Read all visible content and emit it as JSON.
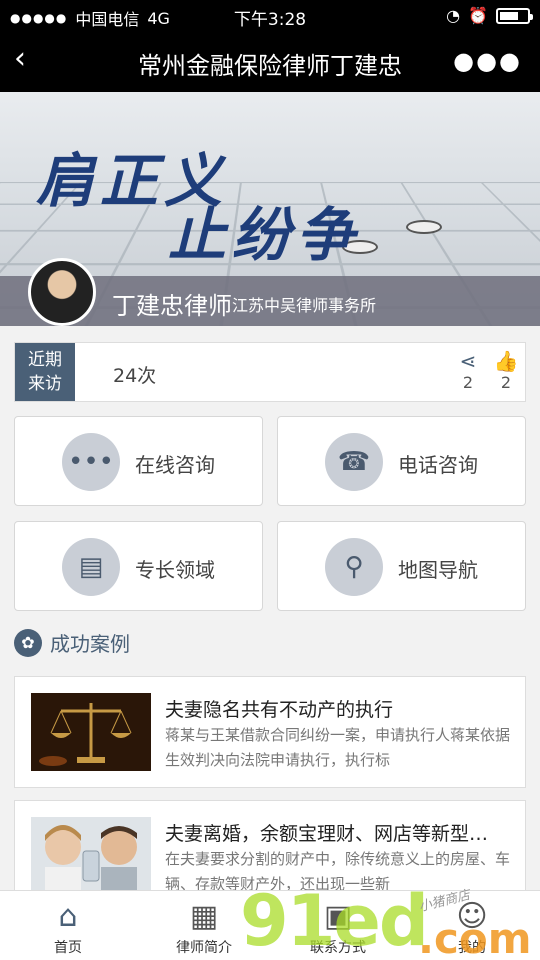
{
  "status_bar": {
    "signal_dots": "●●●●●",
    "carrier": "中国电信",
    "network": "4G",
    "time": "下午3:28"
  },
  "nav": {
    "title": "常州金融保险律师丁建忠"
  },
  "banner": {
    "slogan_line1": "肩正义",
    "slogan_line2": "止纷争"
  },
  "profile": {
    "name": "丁建忠律师",
    "firm": "江苏中吴律师事务所"
  },
  "visits": {
    "label_line1": "近期",
    "label_line2": "来访",
    "count": "24次",
    "shares": "2",
    "likes": "2"
  },
  "services": [
    {
      "label": "在线咨询",
      "icon": "chat-icon"
    },
    {
      "label": "电话咨询",
      "icon": "phone-icon"
    },
    {
      "label": "专长领域",
      "icon": "book-icon"
    },
    {
      "label": "地图导航",
      "icon": "map-pin-icon"
    }
  ],
  "cases_section": {
    "title": "成功案例"
  },
  "cases": [
    {
      "title": "夫妻隐名共有不动产的执行",
      "desc": "蒋某与王某借款合同纠纷一案，申请执行人蒋某依据生效判决向法院申请执行，执行标"
    },
    {
      "title": "夫妻离婚，余额宝理财、网店等新型…",
      "desc": "在夫妻要求分割的财产中，除传统意义上的房屋、车辆、存款等财产外，还出现一些新"
    }
  ],
  "tabs": [
    {
      "label": "首页",
      "icon": "home-icon",
      "active": true
    },
    {
      "label": "律师简介",
      "icon": "profile-icon"
    },
    {
      "label": "联系方式",
      "icon": "contact-icon"
    },
    {
      "label": "我的",
      "icon": "user-icon"
    }
  ],
  "watermark": {
    "brand": "91ed",
    "tld": ".com",
    "note": "小猪商店"
  },
  "colors": {
    "accent": "#4a6077",
    "slogan": "#1e3d7a",
    "nav_bg": "#000000"
  }
}
